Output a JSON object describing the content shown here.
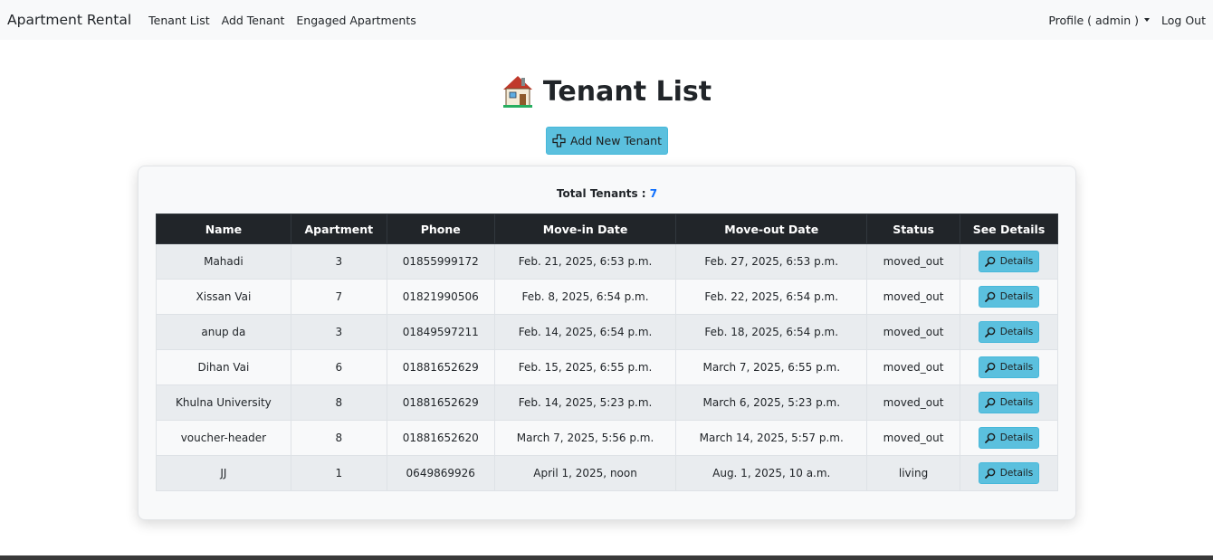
{
  "navbar": {
    "brand": "Apartment Rental",
    "links": [
      "Tenant List",
      "Add Tenant",
      "Engaged Apartments"
    ],
    "profile": "Profile ( admin )",
    "logout": "Log Out"
  },
  "page": {
    "title": "Tenant List",
    "add_button": "Add New Tenant"
  },
  "summary": {
    "label": "Total Tenants :",
    "count": "7",
    "count_color": "#0d6efd"
  },
  "table": {
    "headers": [
      "Name",
      "Apartment",
      "Phone",
      "Move-in Date",
      "Move-out Date",
      "Status",
      "See Details"
    ],
    "details_label": "Details",
    "rows": [
      {
        "name": "Mahadi",
        "apartment": "3",
        "phone": "01855999172",
        "move_in": "Feb. 21, 2025, 6:53 p.m.",
        "move_out": "Feb. 27, 2025, 6:53 p.m.",
        "status": "moved_out"
      },
      {
        "name": "Xissan Vai",
        "apartment": "7",
        "phone": "01821990506",
        "move_in": "Feb. 8, 2025, 6:54 p.m.",
        "move_out": "Feb. 22, 2025, 6:54 p.m.",
        "status": "moved_out"
      },
      {
        "name": "anup da",
        "apartment": "3",
        "phone": "01849597211",
        "move_in": "Feb. 14, 2025, 6:54 p.m.",
        "move_out": "Feb. 18, 2025, 6:54 p.m.",
        "status": "moved_out"
      },
      {
        "name": "Dihan Vai",
        "apartment": "6",
        "phone": "01881652629",
        "move_in": "Feb. 15, 2025, 6:55 p.m.",
        "move_out": "March 7, 2025, 6:55 p.m.",
        "status": "moved_out"
      },
      {
        "name": "Khulna University",
        "apartment": "8",
        "phone": "01881652629",
        "move_in": "Feb. 14, 2025, 5:23 p.m.",
        "move_out": "March 6, 2025, 5:23 p.m.",
        "status": "moved_out"
      },
      {
        "name": "voucher-header",
        "apartment": "8",
        "phone": "01881652620",
        "move_in": "March 7, 2025, 5:56 p.m.",
        "move_out": "March 14, 2025, 5:57 p.m.",
        "status": "moved_out"
      },
      {
        "name": "JJ",
        "apartment": "1",
        "phone": "0649869926",
        "move_in": "April 1, 2025, noon",
        "move_out": "Aug. 1, 2025, 10 a.m.",
        "status": "living"
      }
    ]
  },
  "colors": {
    "button": "#5bc0de",
    "table_header": "#212529",
    "navbar": "#f8f9fa"
  },
  "icons": {
    "title": "house-icon",
    "add": "plus-icon",
    "details": "magnifier-icon"
  }
}
